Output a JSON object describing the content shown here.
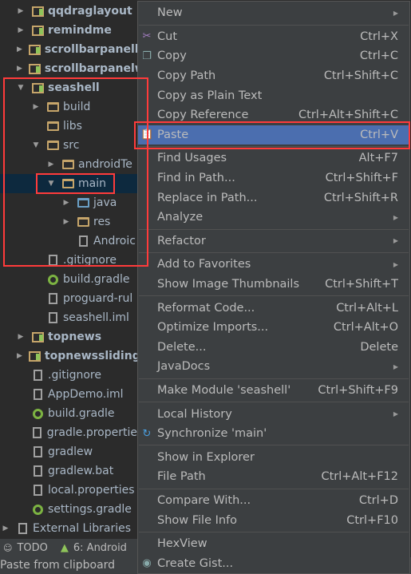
{
  "tree": [
    {
      "label": "qqdraglayout",
      "icon": "module-icon",
      "depth": 1,
      "arrow": "right",
      "bold": true
    },
    {
      "label": "remindme",
      "icon": "module-icon",
      "depth": 1,
      "arrow": "right",
      "bold": true
    },
    {
      "label": "scrollbarpanelli",
      "icon": "library-module-icon",
      "depth": 1,
      "arrow": "right",
      "bold": true
    },
    {
      "label": "scrollbarpanelw",
      "icon": "module-icon",
      "depth": 1,
      "arrow": "right",
      "bold": true
    },
    {
      "label": "seashell",
      "icon": "module-icon",
      "depth": 1,
      "arrow": "down",
      "bold": true
    },
    {
      "label": "build",
      "icon": "folder-icon",
      "depth": 2,
      "arrow": "right"
    },
    {
      "label": "libs",
      "icon": "folder-icon",
      "depth": 2,
      "arrow": ""
    },
    {
      "label": "src",
      "icon": "folder-icon",
      "depth": 2,
      "arrow": "down"
    },
    {
      "label": "androidTe",
      "icon": "folder-icon",
      "depth": 3,
      "arrow": "right"
    },
    {
      "label": "main",
      "icon": "folder-icon",
      "depth": 3,
      "arrow": "down",
      "selected": true
    },
    {
      "label": "java",
      "icon": "source-folder-icon",
      "depth": 4,
      "arrow": "right"
    },
    {
      "label": "res",
      "icon": "resource-folder-icon",
      "depth": 4,
      "arrow": "right"
    },
    {
      "label": "Androic",
      "icon": "manifest-icon",
      "depth": 4,
      "arrow": ""
    },
    {
      "label": ".gitignore",
      "icon": "text-file-icon",
      "depth": 2,
      "arrow": ""
    },
    {
      "label": "build.gradle",
      "icon": "gradle-icon",
      "depth": 2,
      "arrow": ""
    },
    {
      "label": "proguard-rul",
      "icon": "text-file-icon",
      "depth": 2,
      "arrow": ""
    },
    {
      "label": "seashell.iml",
      "icon": "iml-icon",
      "depth": 2,
      "arrow": ""
    },
    {
      "label": "topnews",
      "icon": "module-icon",
      "depth": 1,
      "arrow": "right",
      "bold": true
    },
    {
      "label": "topnewssliding",
      "icon": "library-module-icon",
      "depth": 1,
      "arrow": "right",
      "bold": true
    },
    {
      "label": ".gitignore",
      "icon": "text-file-icon",
      "depth": 1,
      "arrow": ""
    },
    {
      "label": "AppDemo.iml",
      "icon": "iml-icon",
      "depth": 1,
      "arrow": ""
    },
    {
      "label": "build.gradle",
      "icon": "gradle-icon",
      "depth": 1,
      "arrow": ""
    },
    {
      "label": "gradle.propertie",
      "icon": "properties-icon",
      "depth": 1,
      "arrow": ""
    },
    {
      "label": "gradlew",
      "icon": "text-file-icon",
      "depth": 1,
      "arrow": ""
    },
    {
      "label": "gradlew.bat",
      "icon": "text-file-icon",
      "depth": 1,
      "arrow": ""
    },
    {
      "label": "local.properties",
      "icon": "properties-icon",
      "depth": 1,
      "arrow": ""
    },
    {
      "label": "settings.gradle",
      "icon": "gradle-icon",
      "depth": 1,
      "arrow": ""
    },
    {
      "label": "External Libraries",
      "icon": "libraries-icon",
      "depth": 0,
      "arrow": "right"
    }
  ],
  "toolbar": {
    "todo": "TODO",
    "android": "6: Android"
  },
  "status": "Paste from clipboard",
  "menu": [
    {
      "label": "New",
      "submenu": true
    },
    {
      "sep": true
    },
    {
      "label": "Cut",
      "key": "Ctrl+X",
      "icon": "scissors-icon"
    },
    {
      "label": "Copy",
      "key": "Ctrl+C",
      "icon": "copy-icon"
    },
    {
      "label": "Copy Path",
      "key": "Ctrl+Shift+C"
    },
    {
      "label": "Copy as Plain Text"
    },
    {
      "label": "Copy Reference",
      "key": "Ctrl+Alt+Shift+C"
    },
    {
      "label": "Paste",
      "key": "Ctrl+V",
      "icon": "paste-icon",
      "highlighted": true
    },
    {
      "sep": true
    },
    {
      "label": "Find Usages",
      "key": "Alt+F7"
    },
    {
      "label": "Find in Path...",
      "key": "Ctrl+Shift+F"
    },
    {
      "label": "Replace in Path...",
      "key": "Ctrl+Shift+R"
    },
    {
      "label": "Analyze",
      "submenu": true
    },
    {
      "sep": true
    },
    {
      "label": "Refactor",
      "submenu": true
    },
    {
      "sep": true
    },
    {
      "label": "Add to Favorites",
      "submenu": true
    },
    {
      "label": "Show Image Thumbnails",
      "key": "Ctrl+Shift+T"
    },
    {
      "sep": true
    },
    {
      "label": "Reformat Code...",
      "key": "Ctrl+Alt+L"
    },
    {
      "label": "Optimize Imports...",
      "key": "Ctrl+Alt+O"
    },
    {
      "label": "Delete...",
      "key": "Delete"
    },
    {
      "label": "JavaDocs",
      "submenu": true
    },
    {
      "sep": true
    },
    {
      "label": "Make Module 'seashell'",
      "key": "Ctrl+Shift+F9"
    },
    {
      "sep": true
    },
    {
      "label": "Local History",
      "submenu": true
    },
    {
      "label": "Synchronize 'main'",
      "icon": "sync-icon"
    },
    {
      "sep": true
    },
    {
      "label": "Show in Explorer"
    },
    {
      "label": "File Path",
      "key": "Ctrl+Alt+F12"
    },
    {
      "sep": true
    },
    {
      "label": "Compare With...",
      "key": "Ctrl+D"
    },
    {
      "label": "Show File Info",
      "key": "Ctrl+F10"
    },
    {
      "sep": true
    },
    {
      "label": "HexView"
    },
    {
      "label": "Create Gist...",
      "icon": "github-icon"
    }
  ],
  "colors": {
    "highlight": "#4b6eaf",
    "selection": "#0d293e",
    "annotation": "#ff3b3b",
    "menu_bg": "#3c3f41"
  }
}
